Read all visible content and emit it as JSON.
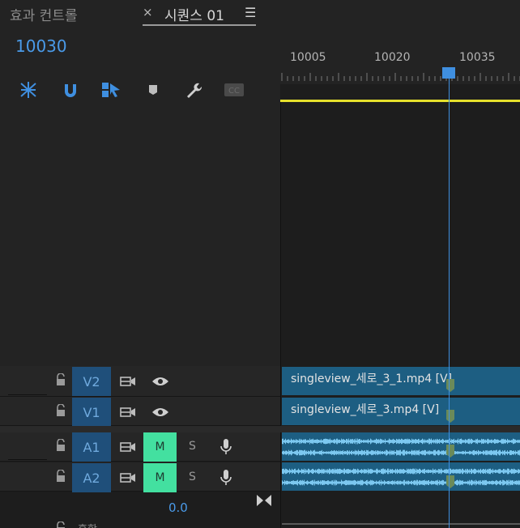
{
  "tabs": {
    "effect_controls": "효과 컨트롤",
    "close": "×",
    "sequence": "시퀀스 01",
    "menu": "☰"
  },
  "timecode": "10030",
  "toolbar": {
    "icons": [
      "nest-icon",
      "snap-icon",
      "linked-selection-icon",
      "marker-icon",
      "wrench-icon",
      "captions-icon"
    ]
  },
  "ruler": {
    "labels": [
      "10005",
      "10020",
      "10035"
    ]
  },
  "tracks": {
    "v2": {
      "label": "V2"
    },
    "v1": {
      "label": "V1"
    },
    "a1": {
      "label": "A1",
      "mute": "M",
      "solo": "S"
    },
    "a2": {
      "label": "A2",
      "mute": "M",
      "solo": "S"
    }
  },
  "clips": {
    "v2": "singleview_세로_3_1.mp4 [V]",
    "v1": "singleview_세로_3.mp4 [V]"
  },
  "master": {
    "value": "0.0",
    "label": "혼합"
  },
  "colors": {
    "accent": "#3f8fe0",
    "clip": "#1d5e82",
    "mute_on": "#43e0a0",
    "work_area": "#e6e02c"
  }
}
